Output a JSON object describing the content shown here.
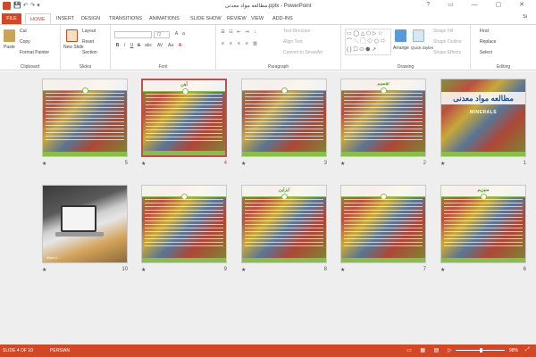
{
  "window": {
    "title": "مطالعه مواد معدنی.pptx - PowerPoint",
    "sign_in": "Si",
    "controls": "? ▭ — ▢ ✕"
  },
  "tabs": [
    {
      "label": "FILE"
    },
    {
      "label": "HOME",
      "active": true
    },
    {
      "label": "INSERT"
    },
    {
      "label": "DESIGN"
    },
    {
      "label": "TRANSITIONS"
    },
    {
      "label": "ANIMATIONS"
    },
    {
      "label": "SLIDE SHOW"
    },
    {
      "label": "REVIEW"
    },
    {
      "label": "VIEW"
    },
    {
      "label": "ADD-INS"
    }
  ],
  "ribbon": {
    "clipboard": {
      "label": "Clipboard",
      "paste": "Paste",
      "cut": "Cut",
      "copy": "Copy",
      "format_painter": "Format Painter"
    },
    "slides": {
      "label": "Slides",
      "new_slide": "New Slide",
      "layout": "Layout",
      "reset": "Reset",
      "section": "Section"
    },
    "font": {
      "label": "Font",
      "size": "72",
      "bold": "B",
      "italic": "I",
      "underline": "U",
      "strike": "S",
      "shadow": "abc",
      "spacing": "AV",
      "case": "Aa",
      "color": "A"
    },
    "paragraph": {
      "label": "Paragraph",
      "text_direction": "Text Direction",
      "align_text": "Align Text",
      "convert_smartart": "Convert to SmartArt"
    },
    "drawing": {
      "label": "Drawing",
      "arrange": "Arrange",
      "quick_styles": "Quick Styles",
      "shape_fill": "Shape Fill",
      "shape_outline": "Shape Outline",
      "shape_effects": "Shape Effects"
    },
    "editing": {
      "label": "Editing",
      "find": "Find",
      "replace": "Replace",
      "select": "Select"
    }
  },
  "slides": [
    {
      "number": "1",
      "title": "مطالعه مواد معدنی",
      "subtitle": "MINERALS",
      "kind": "title"
    },
    {
      "number": "2",
      "title": "تقسیم",
      "kind": "content"
    },
    {
      "number": "3",
      "title": "",
      "kind": "content"
    },
    {
      "number": "4",
      "title": "آهن",
      "kind": "content",
      "selected": true
    },
    {
      "number": "5",
      "title": "",
      "kind": "content"
    },
    {
      "number": "6",
      "title": "منیزیم",
      "kind": "content"
    },
    {
      "number": "7",
      "title": "",
      "kind": "content"
    },
    {
      "number": "8",
      "title": "ایزاین",
      "kind": "content"
    },
    {
      "number": "9",
      "title": "",
      "kind": "content"
    },
    {
      "number": "10",
      "title": "",
      "kind": "photo",
      "caption": "https://..."
    }
  ],
  "star": "★",
  "status": {
    "slide_of": "SLIDE 4 OF 10",
    "language": "PERSIAN",
    "zoom": "98%",
    "zoom_level": 0.49
  },
  "colors": {
    "accent": "#d24726",
    "selected_slide": "#c0504d",
    "slide_green": "#8bbd4a",
    "slide_title_blue": "#1f4e8c"
  }
}
